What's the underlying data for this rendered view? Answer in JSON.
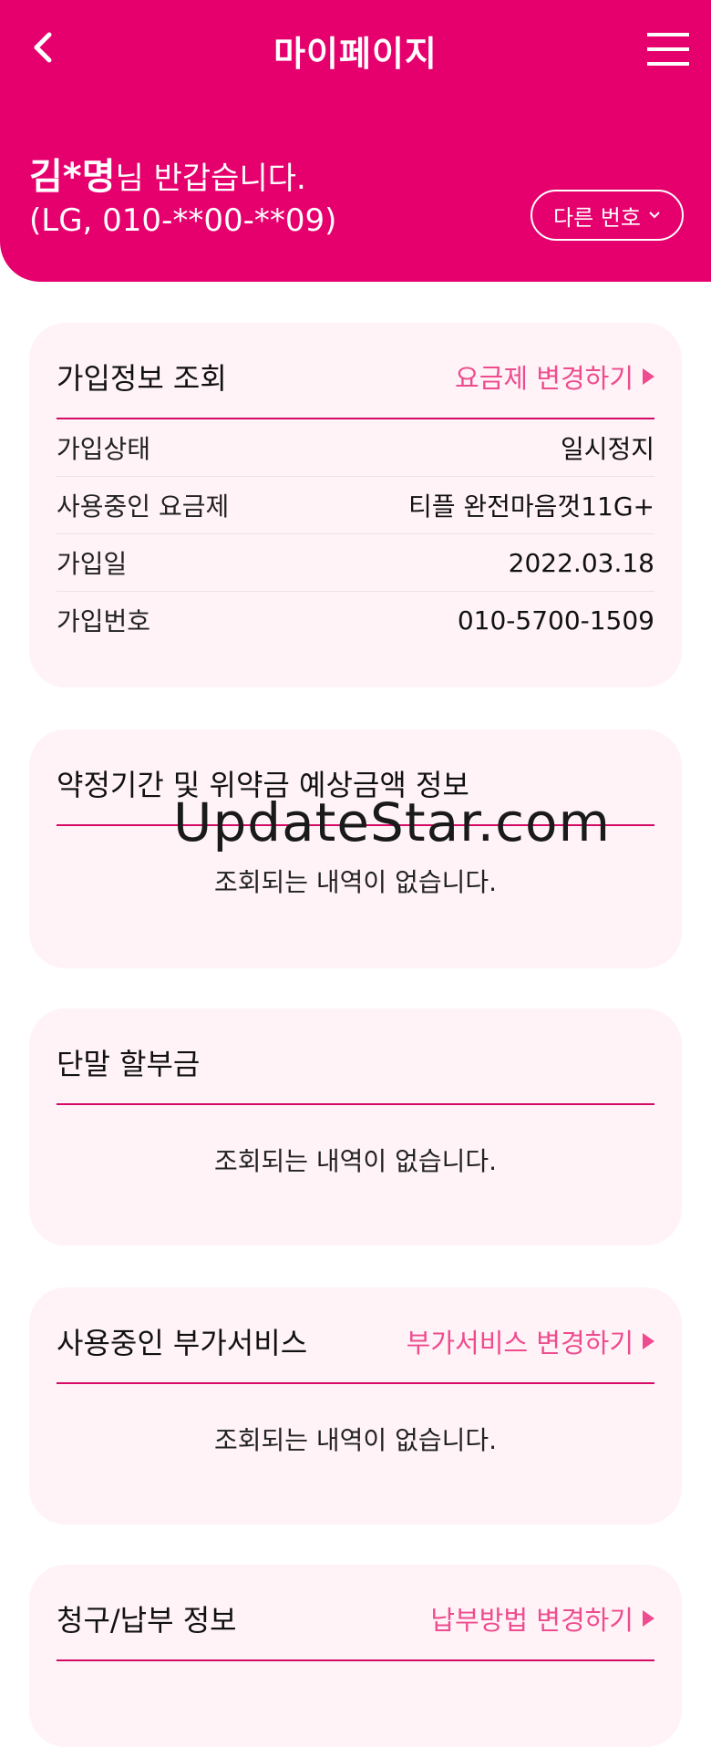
{
  "header": {
    "title": "마이페이지",
    "user_name": "김*명",
    "greeting_suffix": "님 반갑습니다.",
    "subline": "(LG, 010-**00-**09)",
    "switch_number_label": "다른 번호"
  },
  "cards": {
    "subscription": {
      "title": "가입정보 조회",
      "link": "요금제 변경하기",
      "rows": [
        {
          "label": "가입상태",
          "value": "일시정지"
        },
        {
          "label": "사용중인 요금제",
          "value": "티플 완전마음껏11G+"
        },
        {
          "label": "가입일",
          "value": "2022.03.18"
        },
        {
          "label": "가입번호",
          "value": "010-5700-1509"
        }
      ]
    },
    "contract": {
      "title": "약정기간 및 위약금 예상금액 정보",
      "empty": "조회되는 내역이 없습니다."
    },
    "installment": {
      "title": "단말 할부금",
      "empty": "조회되는 내역이 없습니다."
    },
    "addon": {
      "title": "사용중인 부가서비스",
      "link": "부가서비스 변경하기",
      "empty": "조회되는 내역이 없습니다."
    },
    "billing": {
      "title": "청구/납부 정보",
      "link": "납부방법 변경하기"
    }
  },
  "watermark": "UpdateStar.com",
  "colors": {
    "accent": "#e6006e",
    "card_bg": "#fff3f7",
    "link": "#ee4c8e"
  }
}
